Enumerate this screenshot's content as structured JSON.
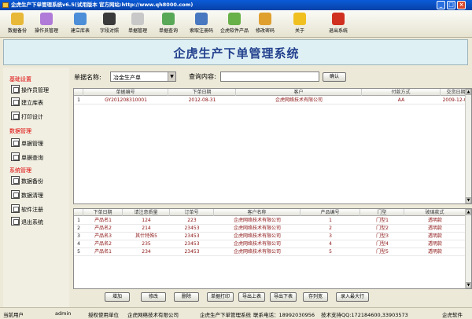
{
  "titlebar": {
    "title": "企虎生产下单管理系统v6.5(试用版本 官方网站:http://www.qh8000.com)"
  },
  "toolbar": [
    {
      "name": "data-backup",
      "label": "数据备份",
      "color": "#e8b838"
    },
    {
      "name": "operator-mgmt",
      "label": "操作员管理",
      "color": "#b07ad8"
    },
    {
      "name": "build-db",
      "label": "建立库表",
      "color": "#4c8ed8"
    },
    {
      "name": "field-compare",
      "label": "字段对照",
      "color": "#3a3a3a"
    },
    {
      "name": "order-mgmt",
      "label": "单据管理",
      "color": "#c8c8c8"
    },
    {
      "name": "order-query",
      "label": "单据查询",
      "color": "#58a858"
    },
    {
      "name": "reg-code",
      "label": "索取注册码",
      "color": "#4878c0"
    },
    {
      "name": "qihu-software",
      "label": "企虎软件产品",
      "color": "#68b048"
    },
    {
      "name": "change-password",
      "label": "修改密码",
      "color": "#e0a030"
    },
    {
      "name": "about",
      "label": "关于",
      "color": "#f0c020"
    },
    {
      "name": "exit",
      "label": "退出系统",
      "color": "#d03020"
    }
  ],
  "banner": {
    "title": "企虎生产下单管理系统"
  },
  "sidebar": {
    "sections": [
      {
        "title": "基础设置",
        "items": [
          "操作员管理",
          "建立库表",
          "打印设计"
        ]
      },
      {
        "title": "数据管理",
        "items": [
          "单据管理",
          "单据查询"
        ]
      },
      {
        "title": "系统管理",
        "items": [
          "数据备份",
          "数据清理",
          "软件注册",
          "退出系统"
        ]
      }
    ]
  },
  "filter": {
    "doc_label": "单据名称:",
    "doc_value": "冶金生产单",
    "query_label": "查询内容:",
    "query_value": "",
    "confirm": "确认"
  },
  "grid1": {
    "headers": [
      "",
      "单据编号",
      "下单日期",
      "客户",
      "付款方式",
      "交货日期"
    ],
    "rows": [
      [
        "1",
        "GY201208310001",
        "2012-08-31",
        "企虎网络技术有限公司",
        "AA",
        "2009-12-01"
      ]
    ]
  },
  "grid2": {
    "headers": [
      "",
      "下单日期",
      "请注意质量",
      "订单号",
      "客户名称",
      "产品编号",
      "门型",
      "玻璃款式"
    ],
    "rows": [
      [
        "1",
        "产品名1",
        "124",
        "223",
        "企虎网络技术有限公司",
        "1",
        "门型1",
        "透明款"
      ],
      [
        "2",
        "产品名2",
        "214",
        "23453",
        "企虎网络技术有限公司",
        "2",
        "门型2",
        "透明款"
      ],
      [
        "3",
        "产品名3",
        "其什特殊5",
        "23453",
        "企虎网络技术有限公司",
        "3",
        "门型3",
        "透明款"
      ],
      [
        "4",
        "产品名2",
        "235",
        "23453",
        "企虎网络技术有限公司",
        "4",
        "门型4",
        "透明款"
      ],
      [
        "5",
        "产品名1",
        "234",
        "23453",
        "企虎网络技术有限公司",
        "5",
        "门型5",
        "透明款"
      ]
    ]
  },
  "buttons": [
    "增加",
    "修改",
    "删除",
    "单据打印",
    "导出上表",
    "导出下表",
    "存列宽",
    "录入最大行"
  ],
  "status": {
    "user_label": "当前用户",
    "user": "admin",
    "unit_label": "授权使用单位",
    "unit": "企虎网络技术有限公司",
    "product": "企虎生产下单管理系统",
    "phone": "联系电话：18992030956",
    "support": "技术支持QQ:172184600,33903573",
    "brand": "企虎软件"
  }
}
